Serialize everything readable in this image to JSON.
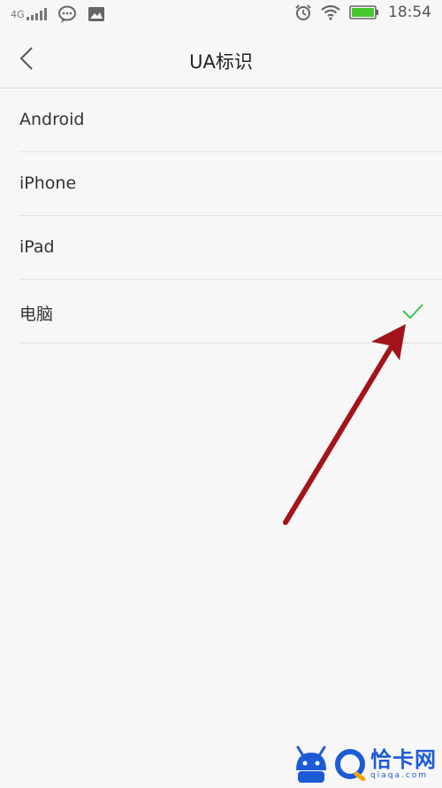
{
  "status_bar": {
    "network_label": "4G",
    "time": "18:54"
  },
  "header": {
    "title": "UA标识",
    "back_icon": "chevron-left-icon"
  },
  "options": [
    {
      "label": "Android",
      "selected": false
    },
    {
      "label": "iPhone",
      "selected": false
    },
    {
      "label": "iPad",
      "selected": false
    },
    {
      "label": "电脑",
      "selected": true
    }
  ],
  "colors": {
    "check": "#3cc351",
    "arrow": "#a3141a",
    "battery": "#45c82f",
    "watermark": "#1d5bd6"
  },
  "watermark": {
    "brand": "恰卡网",
    "url": "qiaqa.com"
  }
}
